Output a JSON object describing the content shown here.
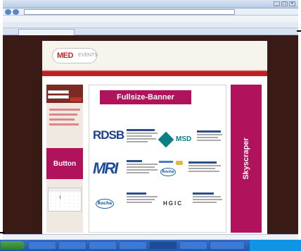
{
  "browser": {
    "title": "",
    "address": "",
    "menu_items": [
      "",
      "",
      "",
      "",
      "",
      ""
    ],
    "links_text": "",
    "tab_label": "",
    "tools_text": ""
  },
  "site": {
    "logo_primary": "MED",
    "logo_secondary": "EVENTS",
    "headline": "",
    "subheadline": "",
    "top_links": "",
    "redbar_text": ""
  },
  "ads": {
    "banner_label": "Fullsize-Banner",
    "button_label": "Button",
    "skyscraper_label": "Skyscraper"
  },
  "partners": [
    {
      "logo": "RDSB",
      "logo_color": "#1b3f8b"
    },
    {
      "logo": "MSD",
      "logo_color": "#0a7f86"
    },
    {
      "logo": "MRI",
      "logo_color": "#1e4aa0"
    },
    {
      "logo": "Roche",
      "logo_color": "#1b5faa"
    },
    {
      "logo": "Roche",
      "logo_color": "#1b5faa"
    },
    {
      "logo": "HGIC",
      "logo_color": "#2a2a2a"
    }
  ],
  "colors": {
    "ad_magenta": "#b0125b",
    "brand_red": "#c01e22",
    "frame_dark": "#3a1a14"
  }
}
